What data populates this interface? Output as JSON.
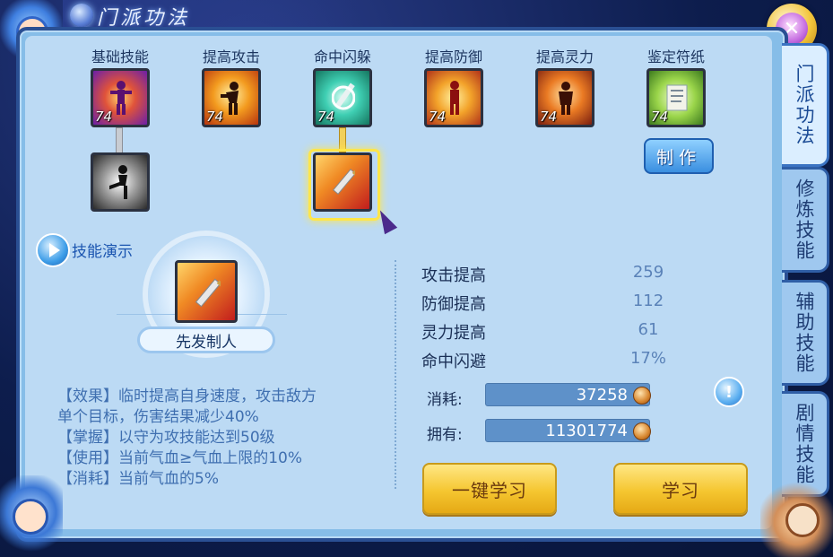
{
  "window": {
    "title": "门派功法"
  },
  "close_button": {
    "glyph": "✕"
  },
  "tabs": [
    {
      "label": "门派功法",
      "active": true
    },
    {
      "label": "修炼技能",
      "active": false
    },
    {
      "label": "辅助技能",
      "active": false
    },
    {
      "label": "剧情技能",
      "active": false
    }
  ],
  "skill_columns": [
    {
      "label": "基础技能",
      "level": "74",
      "icon": "muscle-figure-icon"
    },
    {
      "label": "提高攻击",
      "level": "74",
      "icon": "attack-figure-icon"
    },
    {
      "label": "命中闪躲",
      "level": "74",
      "icon": "sword-swirl-icon"
    },
    {
      "label": "提高防御",
      "level": "74",
      "icon": "defense-figure-icon"
    },
    {
      "label": "提高灵力",
      "level": "74",
      "icon": "spirit-figure-icon"
    },
    {
      "label": "鉴定符纸",
      "level": "74",
      "icon": "scroll-icon"
    }
  ],
  "sub_skills": [
    {
      "icon": "kick-figure-icon",
      "selected": false
    },
    {
      "icon": "sword-icon",
      "selected": true
    }
  ],
  "make_button": {
    "label": "制作"
  },
  "demo": {
    "label": "技能演示"
  },
  "selected_skill": {
    "name": "先发制人",
    "description": [
      "【效果】临时提高自身速度，攻击敌方",
      "单个目标，伤害结果减少40%",
      "【掌握】以守为攻技能达到50级",
      "【使用】当前气血≥气血上限的10%",
      "【消耗】当前气血的5%"
    ]
  },
  "stats": [
    {
      "label": "攻击提高",
      "value": "259"
    },
    {
      "label": "防御提高",
      "value": "112"
    },
    {
      "label": "灵力提高",
      "value": "61"
    },
    {
      "label": "命中闪避",
      "value": "17%"
    }
  ],
  "cost": {
    "label": "消耗:",
    "value": "37258"
  },
  "owned": {
    "label": "拥有:",
    "value": "11301774"
  },
  "buttons": {
    "learn_all": "一键学习",
    "learn": "学习"
  }
}
